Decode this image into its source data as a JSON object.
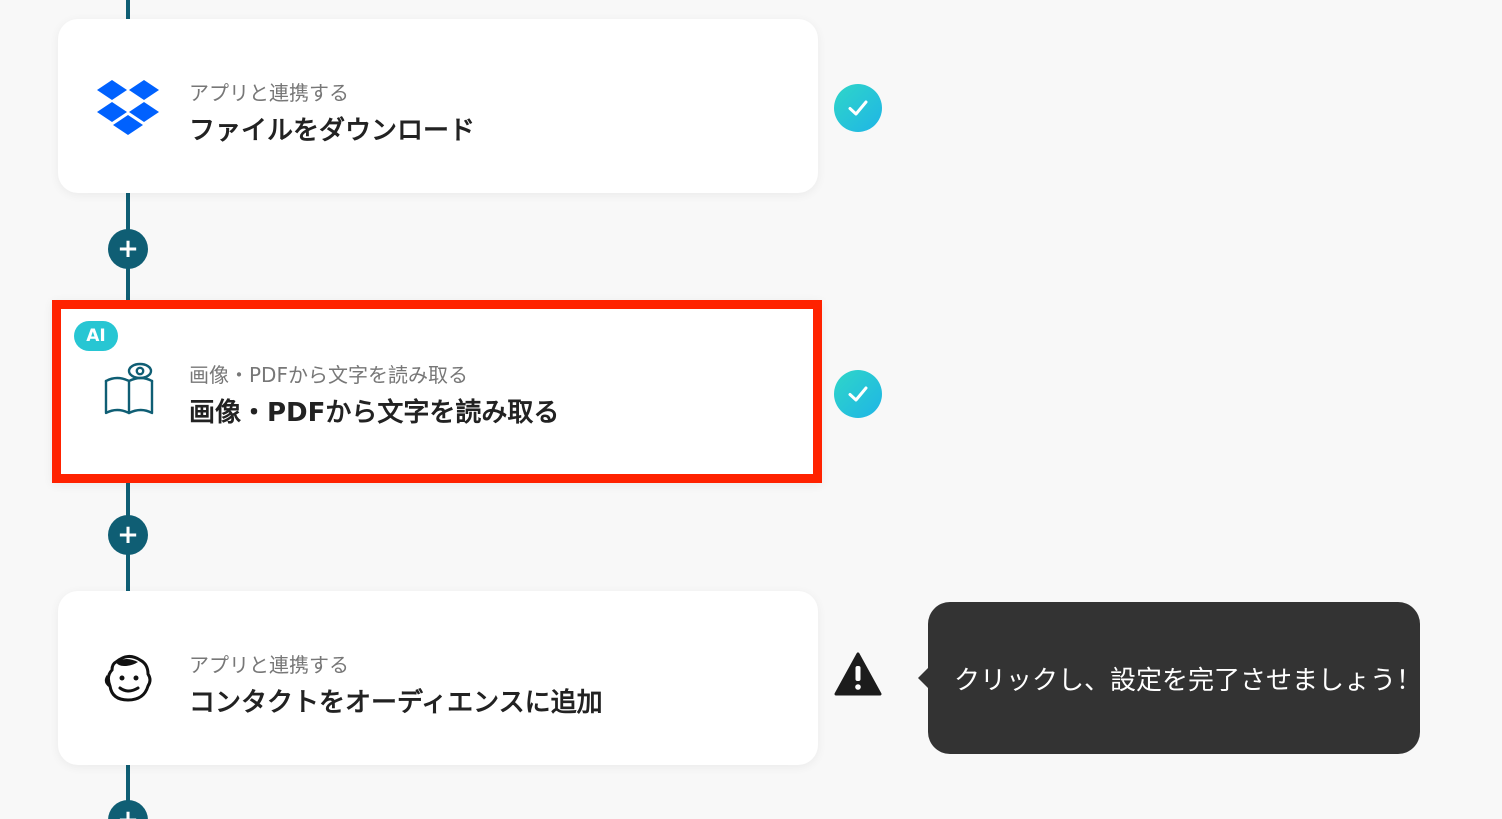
{
  "steps": [
    {
      "subtitle": "アプリと連携する",
      "title": "ファイルをダウンロード",
      "icon": "dropbox-icon",
      "status": "complete"
    },
    {
      "badge": "AI",
      "subtitle": "画像・PDFから文字を読み取る",
      "title": "画像・PDFから文字を読み取る",
      "icon": "ocr-book-eye-icon",
      "status": "complete"
    },
    {
      "subtitle": "アプリと連携する",
      "title": "コンタクトをオーディエンスに追加",
      "icon": "mailchimp-icon",
      "status": "warning"
    }
  ],
  "add_step_label": "+",
  "tooltip": {
    "text": "クリックし、設定を完了させましょう！"
  },
  "colors": {
    "connector": "#0f5e74",
    "highlight_border": "#ff2200",
    "ai_badge": "#27c6d3",
    "check_start": "#2fd6c8",
    "check_end": "#1fb5e6",
    "tooltip_bg": "#333333"
  }
}
